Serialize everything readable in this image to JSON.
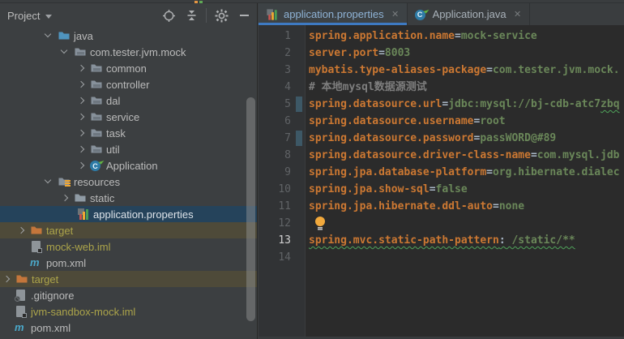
{
  "colors": {
    "panel_bg": "#3C3F41",
    "editor_bg": "#2B2B2B",
    "selection_row": "#25435B",
    "excluded_row_bg": "#4E4A39",
    "excluded_text": "#ACA44A",
    "property_key": "#CC7832",
    "property_value": "#6A8759",
    "comment": "#7E7E7E",
    "tab_underline": "#3E7AC2",
    "typo_wave": "#4FA35A",
    "change_marker": "#3D5866"
  },
  "project_panel": {
    "header": {
      "title": "Project"
    },
    "tree": [
      {
        "label": "java",
        "type": "folder-source",
        "state": "expanded"
      },
      {
        "label": "com.tester.jvm.mock",
        "type": "folder-package",
        "state": "expanded"
      },
      {
        "label": "common",
        "type": "folder-package",
        "state": "collapsed"
      },
      {
        "label": "controller",
        "type": "folder-package",
        "state": "collapsed"
      },
      {
        "label": "dal",
        "type": "folder-package",
        "state": "collapsed"
      },
      {
        "label": "service",
        "type": "folder-package",
        "state": "collapsed"
      },
      {
        "label": "task",
        "type": "folder-package",
        "state": "collapsed"
      },
      {
        "label": "util",
        "type": "folder-package",
        "state": "collapsed"
      },
      {
        "label": "Application",
        "type": "class",
        "state": "collapsed"
      },
      {
        "label": "resources",
        "type": "folder-resources",
        "state": "expanded"
      },
      {
        "label": "static",
        "type": "folder",
        "state": "collapsed"
      },
      {
        "label": "application.properties",
        "type": "properties-file",
        "selected": true
      },
      {
        "label": "target",
        "type": "folder-excluded",
        "state": "collapsed"
      },
      {
        "label": "mock-web.iml",
        "type": "iml-file"
      },
      {
        "label": "pom.xml",
        "type": "maven-file"
      },
      {
        "label": "target",
        "type": "folder-excluded",
        "state": "collapsed"
      },
      {
        "label": ".gitignore",
        "type": "gitignore-file"
      },
      {
        "label": "jvm-sandbox-mock.iml",
        "type": "iml-file"
      },
      {
        "label": "pom.xml",
        "type": "maven-file"
      }
    ]
  },
  "editor": {
    "tabs": [
      {
        "label": "application.properties",
        "icon": "properties-file",
        "active": true
      },
      {
        "label": "Application.java",
        "icon": "class",
        "active": false
      }
    ],
    "lines": [
      {
        "num": "1",
        "key": "spring.application.name",
        "eq": "=",
        "val": "mock-service"
      },
      {
        "num": "2",
        "key": "server.port",
        "eq": "=",
        "val": "8003"
      },
      {
        "num": "3",
        "key": "mybatis.type-aliases-package",
        "eq": "=",
        "val": "com.tester.jvm.mock."
      },
      {
        "num": "4",
        "comment": "# 本地mysql数据源测试"
      },
      {
        "num": "5",
        "key": "spring.datasource.url",
        "eq": "=",
        "val": "jdbc:mysql://bj-cdb-atc7",
        "val_typo": "zbq"
      },
      {
        "num": "6",
        "key": "spring.datasource.username",
        "eq": "=",
        "val": "root"
      },
      {
        "num": "7",
        "key": "spring.datasource.password",
        "eq": "=",
        "val": "passWORD@#89"
      },
      {
        "num": "8",
        "key": "spring.datasource.driver-class-name",
        "eq": "=",
        "val": "com.mysql.jdb"
      },
      {
        "num": "9",
        "key": "spring.jpa.database-platform",
        "eq": "=",
        "val": "org.hibernate.dialec"
      },
      {
        "num": "10",
        "key": "spring.jpa.show-sql",
        "eq": "=",
        "val": "false"
      },
      {
        "num": "11",
        "key": "spring.jpa.hibernate.ddl-auto",
        "eq": "=",
        "val": "none"
      },
      {
        "num": "12"
      },
      {
        "num": "13",
        "key": "spring.mvc.static-path-pattern",
        "eq": ":",
        "val": " /static/**"
      },
      {
        "num": "14"
      }
    ]
  }
}
